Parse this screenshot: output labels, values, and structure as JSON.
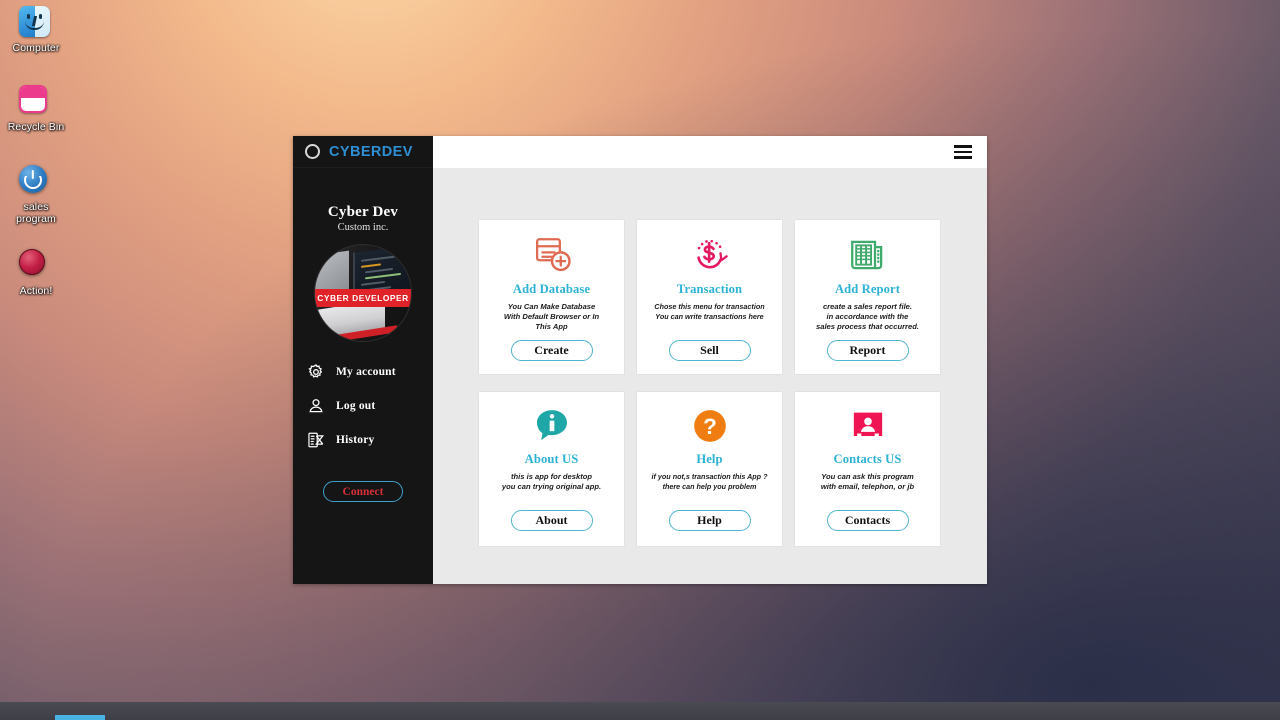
{
  "desktop": {
    "icons": [
      {
        "label": "Computer",
        "icon": "computer-finder-icon"
      },
      {
        "label": "Recycle Bin",
        "icon": "recycle-bin-icon"
      },
      {
        "label": "sales\nprogram",
        "icon": "power-button-icon"
      },
      {
        "label": "Action!",
        "icon": "record-circle-icon"
      }
    ]
  },
  "window": {
    "sidebar": {
      "brand": "CYBERDEV",
      "brand_color": "#2e8fd4",
      "title": "Cyber Dev",
      "subtitle": "Custom inc.",
      "avatar_banner": "CYBER DEVELOPER",
      "menu": [
        {
          "label": "My account",
          "icon": "gear-icon"
        },
        {
          "label": "Log out",
          "icon": "user-icon"
        },
        {
          "label": "History",
          "icon": "history-icon"
        }
      ],
      "connect_label": "Connect",
      "connect_color": "#d82f3a",
      "border_color": "#3ea0c9"
    },
    "topbar": {
      "menu_icon": "hamburger-menu-icon"
    },
    "cards": [
      {
        "title": "Add Database",
        "desc": "You Can Make Database\nWith Default Browser or In\nThis App",
        "button": "Create",
        "icon": "database-add-icon",
        "icon_color": "#e06a52"
      },
      {
        "title": "Transaction",
        "desc": "Chose this menu for transaction\nYou can write transactions here",
        "button": "Sell",
        "icon": "dollar-refresh-icon",
        "icon_color": "#e51a63"
      },
      {
        "title": "Add Report",
        "desc": "create a sales report file.\nin accordance with the\nsales process that occurred.",
        "button": "Report",
        "icon": "report-newspaper-icon",
        "icon_color": "#3faa6b"
      },
      {
        "title": "About US",
        "desc": "this is app for desktop\nyou can trying original app.",
        "button": "About",
        "icon": "info-bubble-icon",
        "icon_color": "#1fa7a7"
      },
      {
        "title": "Help",
        "desc": "if you not,s transaction this App ?\nthere can help you problem",
        "button": "Help",
        "icon": "question-mark-icon",
        "icon_color": "#f07d12"
      },
      {
        "title": "Contacts US",
        "desc": "You can ask this program\nwith email, telephon, or jb",
        "button": "Contacts",
        "icon": "contact-card-icon",
        "icon_color": "#ef1454"
      }
    ],
    "title_color": "#2cb2d4"
  },
  "taskbar": {
    "progress_color": "#49b4e4"
  }
}
